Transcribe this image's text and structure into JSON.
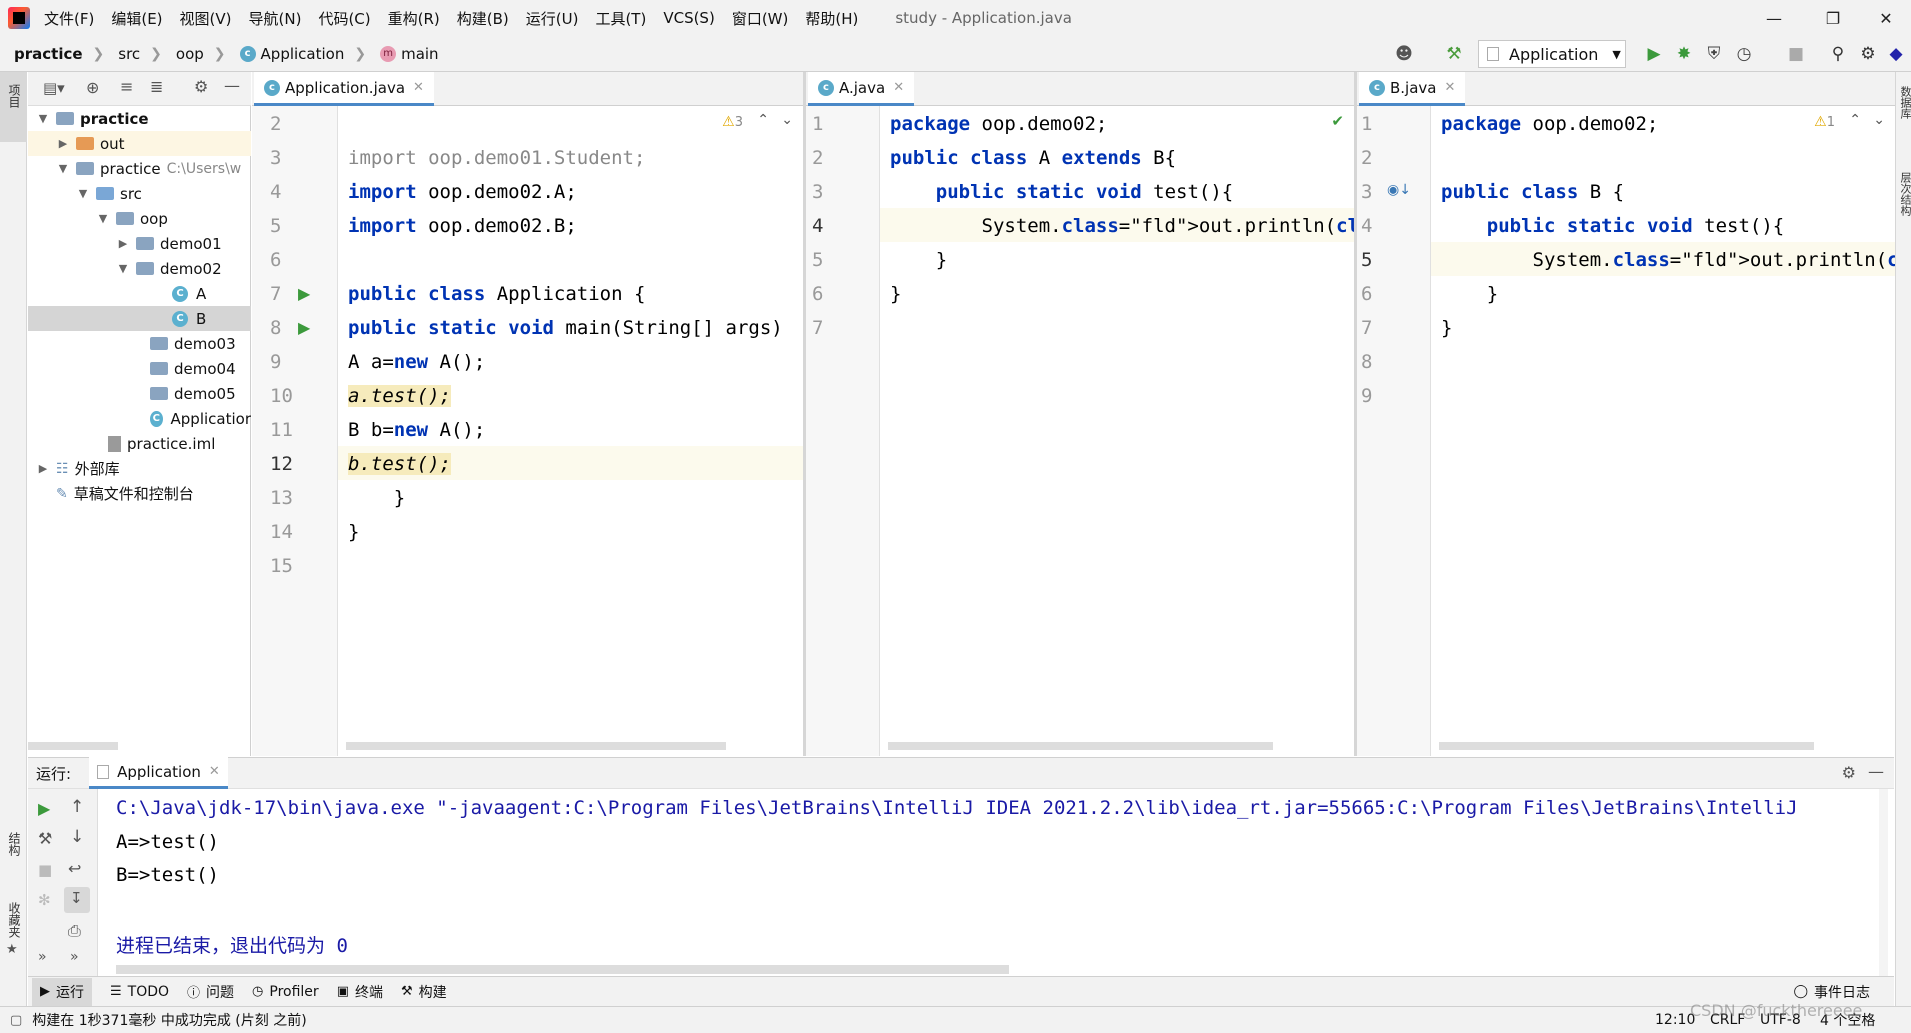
{
  "menubar": {
    "items": [
      "文件(F)",
      "编辑(E)",
      "视图(V)",
      "导航(N)",
      "代码(C)",
      "重构(R)",
      "构建(B)",
      "运行(U)",
      "工具(T)",
      "VCS(S)",
      "窗口(W)",
      "帮助(H)"
    ],
    "window_title": "study - Application.java"
  },
  "navbar": {
    "crumbs": [
      "practice",
      "src",
      "oop",
      "Application",
      "main"
    ],
    "run_config": "Application"
  },
  "left_strip": {
    "project_label": "项目",
    "structure_label": "结构",
    "favorites_label": "收藏夹"
  },
  "right_strip": {
    "database_label": "数据库",
    "hierarchy_label": "层次结构"
  },
  "project_tree": [
    {
      "label": "practice",
      "kind": "root"
    },
    {
      "label": "out",
      "kind": "folder-orange"
    },
    {
      "label": "practice",
      "hint": "C:\\Users\\w",
      "kind": "module"
    },
    {
      "label": "src",
      "kind": "folder-src"
    },
    {
      "label": "oop",
      "kind": "package"
    },
    {
      "label": "demo01",
      "kind": "package"
    },
    {
      "label": "demo02",
      "kind": "package"
    },
    {
      "label": "A",
      "kind": "class"
    },
    {
      "label": "B",
      "kind": "class"
    },
    {
      "label": "demo03",
      "kind": "package"
    },
    {
      "label": "demo04",
      "kind": "package"
    },
    {
      "label": "demo05",
      "kind": "package"
    },
    {
      "label": "Applicatior",
      "kind": "class"
    },
    {
      "label": "practice.iml",
      "kind": "file"
    },
    {
      "label": "外部库",
      "kind": "lib"
    },
    {
      "label": "草稿文件和控制台",
      "kind": "scratch"
    }
  ],
  "editor1": {
    "tab": "Application.java",
    "warnings": "3",
    "line_numbers": [
      "2",
      "3",
      "4",
      "5",
      "6",
      "7",
      "8",
      "9",
      "10",
      "11",
      "12",
      "13",
      "14",
      "15"
    ],
    "code": [
      "",
      "import oop.demo01.Student;",
      "import oop.demo02.A;",
      "import oop.demo02.B;",
      "",
      "public class Application {",
      "public static void main(String[] args)",
      "A a=new A();",
      "a.test();",
      "B b=new A();",
      "b.test();",
      "    }",
      "}",
      ""
    ]
  },
  "editor2": {
    "tab": "A.java",
    "line_numbers": [
      "1",
      "2",
      "3",
      "4",
      "5",
      "6",
      "7"
    ],
    "code": [
      "package oop.demo02;",
      "public class A extends B{",
      "    public static void test(){",
      "        System.out.println(\"A=>test()\")",
      "    }",
      "}",
      ""
    ]
  },
  "editor3": {
    "tab": "B.java",
    "warnings": "1",
    "line_numbers": [
      "1",
      "2",
      "3",
      "4",
      "5",
      "6",
      "7",
      "8",
      "9"
    ],
    "code": [
      "package oop.demo02;",
      "",
      "public class B {",
      "    public static void test(){",
      "        System.out.println(\"B=>test()\"",
      "    }",
      "}",
      "",
      ""
    ]
  },
  "run_panel": {
    "label": "运行:",
    "tab": "Application",
    "console": [
      "C:\\Java\\jdk-17\\bin\\java.exe \"-javaagent:C:\\Program Files\\JetBrains\\IntelliJ IDEA 2021.2.2\\lib\\idea_rt.jar=55665:C:\\Program Files\\JetBrains\\IntelliJ",
      "A=>test()",
      "B=>test()",
      "",
      "进程已结束，退出代码为 0"
    ]
  },
  "tool_windows": [
    "运行",
    "TODO",
    "问题",
    "Profiler",
    "终端",
    "构建"
  ],
  "event_log": "事件日志",
  "status": {
    "message": "构建在 1秒371毫秒 中成功完成 (片刻 之前)",
    "position": "12:10",
    "line_sep": "CRLF",
    "encoding": "UTF-8",
    "indent": "4 个空格"
  },
  "watermark": "CSDN @fuckthereeee"
}
